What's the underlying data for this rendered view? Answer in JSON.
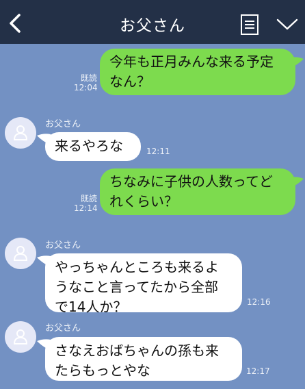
{
  "header": {
    "title": "お父さん",
    "back_icon": "chevron-left-icon",
    "menu_icon": "list-icon",
    "more_icon": "chevron-down-icon",
    "background": "#233047"
  },
  "colors": {
    "chat_background": "#7391c3",
    "outgoing_bubble": "#7ddb4e",
    "incoming_bubble": "#ffffff"
  },
  "messages": [
    {
      "direction": "outgoing",
      "text": "今年も正月みんな来る予定\nなん？",
      "read": "既読",
      "time": "12:04"
    },
    {
      "direction": "incoming",
      "sender": "お父さん",
      "text": "来るやろな",
      "time": "12:11"
    },
    {
      "direction": "outgoing",
      "text": "ちなみに子供の人数ってど\nれくらい？",
      "read": "既読",
      "time": "12:14"
    },
    {
      "direction": "incoming",
      "sender": "お父さん",
      "text": "やっちゃんところも来るよ\nうなこと言ってたから全部\nで14人か？",
      "time": "12:16"
    },
    {
      "direction": "incoming",
      "sender": "お父さん",
      "text": "さなえおばちゃんの孫も来\nたらもっとやな",
      "time": "12:17"
    }
  ]
}
